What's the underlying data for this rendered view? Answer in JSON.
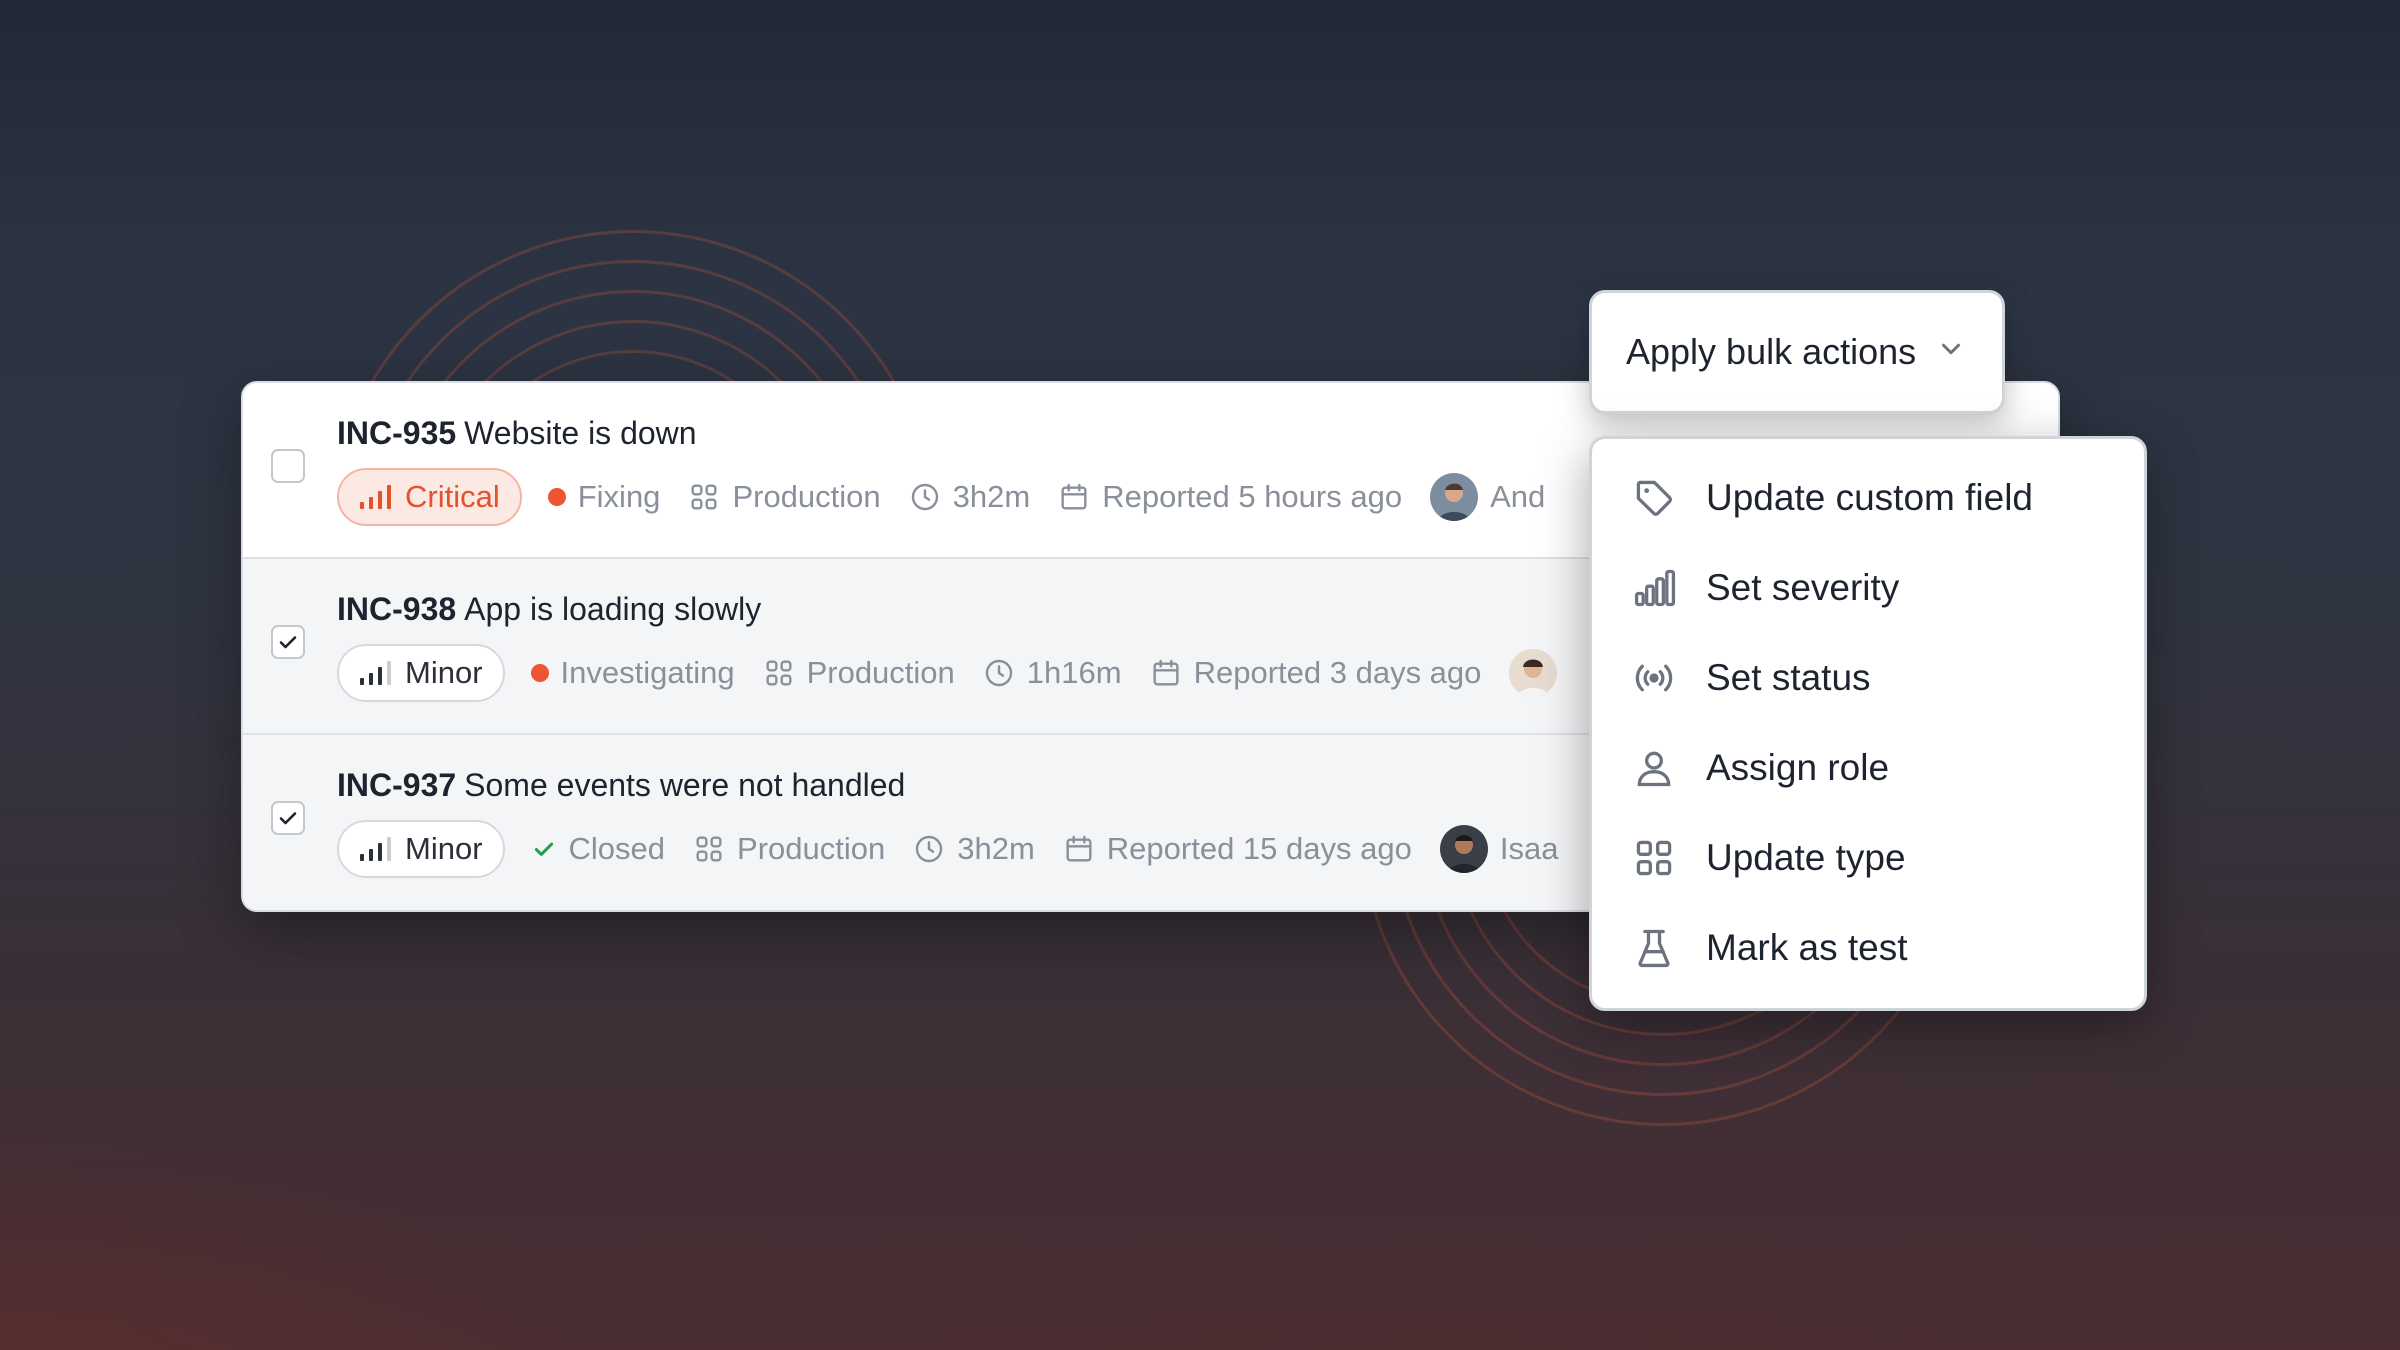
{
  "colors": {
    "accent_critical": "#e4512a",
    "status_red": "#ef5533",
    "status_green": "#22a04a",
    "muted_text": "#8a909b"
  },
  "incidents": [
    {
      "ref": "INC-935",
      "title": "Website is down",
      "selected": false,
      "severity": "Critical",
      "severity_level": "critical",
      "status": "Fixing",
      "status_icon": "red-dot",
      "type": "Production",
      "duration": "3h2m",
      "reported": "Reported 5 hours ago",
      "lead": "And"
    },
    {
      "ref": "INC-938",
      "title": "App is loading slowly",
      "selected": true,
      "severity": "Minor",
      "severity_level": "minor",
      "status": "Investigating",
      "status_icon": "red-dot",
      "type": "Production",
      "duration": "1h16m",
      "reported": "Reported 3 days ago",
      "lead": ""
    },
    {
      "ref": "INC-937",
      "title": "Some events were not handled",
      "selected": true,
      "severity": "Minor",
      "severity_level": "minor",
      "status": "Closed",
      "status_icon": "green-check",
      "type": "Production",
      "duration": "3h2m",
      "reported": "Reported 15 days ago",
      "lead": "Isaa"
    }
  ],
  "bulk_actions": {
    "label": "Apply bulk actions",
    "icon": "chevron-down-icon",
    "items": [
      {
        "label": "Update custom field",
        "icon": "tag-icon"
      },
      {
        "label": "Set severity",
        "icon": "bar-chart-icon"
      },
      {
        "label": "Set status",
        "icon": "broadcast-icon"
      },
      {
        "label": "Assign role",
        "icon": "user-icon"
      },
      {
        "label": "Update type",
        "icon": "grid-icon"
      },
      {
        "label": "Mark as test",
        "icon": "flask-icon"
      }
    ]
  }
}
